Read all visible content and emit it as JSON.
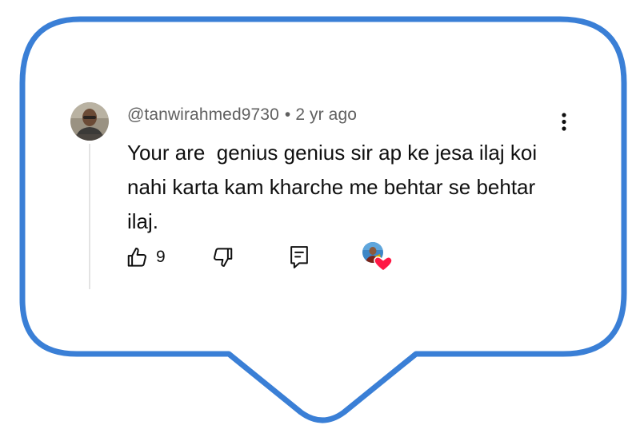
{
  "comment": {
    "author": "@tanwirahmed9730",
    "separator": "•",
    "time_ago": "2 yr ago",
    "text": "Your are  genius genius sir ap ke jesa ilaj koi nahi karta kam kharche me behtar se behtar ilaj."
  },
  "actions": {
    "like_count": "9",
    "like_icon": "thumbs-up-icon",
    "dislike_icon": "thumbs-down-icon",
    "reply_icon": "reply-comment-icon",
    "hearted_icon": "creator-heart-icon",
    "more_icon": "more-vertical-icon"
  },
  "colors": {
    "bubble_border": "#3a7fd6",
    "text_primary": "#0f0f0f",
    "text_secondary": "#606060",
    "heart": "#ff1744"
  }
}
